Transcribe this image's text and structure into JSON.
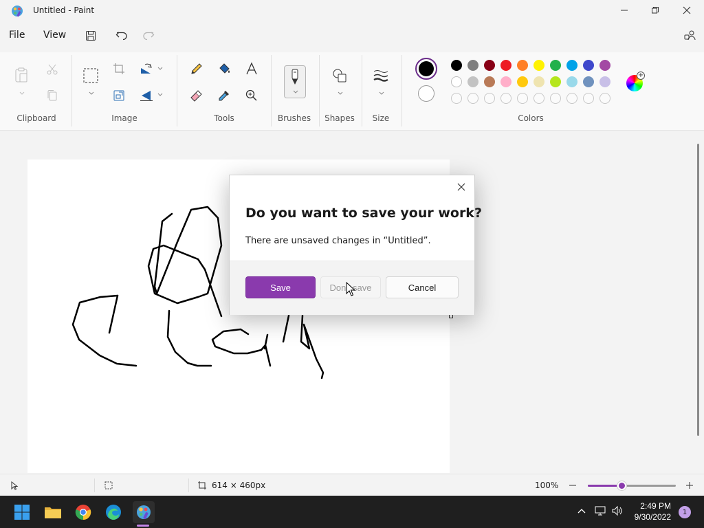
{
  "window": {
    "title": "Untitled - Paint"
  },
  "menu": {
    "file": "File",
    "view": "View"
  },
  "ribbon": {
    "groups": {
      "clipboard": "Clipboard",
      "image": "Image",
      "tools": "Tools",
      "brushes": "Brushes",
      "shapes": "Shapes",
      "size": "Size",
      "colors": "Colors"
    },
    "primary_color": "#000000",
    "secondary_color": "#ffffff",
    "palette_row1": [
      "#000000",
      "#7f7f7f",
      "#880015",
      "#ed1c24",
      "#ff7f27",
      "#fff200",
      "#22b14c",
      "#00a2e8",
      "#3f48cc",
      "#a349a4"
    ],
    "palette_row2": [
      "#ffffff",
      "#c3c3c3",
      "#b97a57",
      "#ffaec9",
      "#ffc90e",
      "#efe4b0",
      "#b5e61d",
      "#99d9ea",
      "#7092be",
      "#c8bfe7"
    ]
  },
  "dialog": {
    "title": "Do you want to save your work?",
    "message": "There are unsaved changes in “Untitled”.",
    "save": "Save",
    "dont_save": "Don't save",
    "cancel": "Cancel"
  },
  "status": {
    "canvas_size": "614 × 460px",
    "zoom": "100%",
    "zoom_level": 0.38
  },
  "taskbar": {
    "time": "2:49 PM",
    "date": "9/30/2022",
    "notifications": "1"
  },
  "colors": {
    "accent": "#8a3aad"
  }
}
